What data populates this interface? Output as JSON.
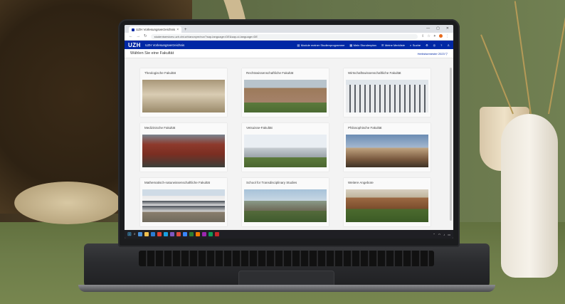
{
  "browser": {
    "tab_title": "UZH Vorlesungsverzeichnis",
    "tab_close": "×",
    "new_tab": "+",
    "window_controls": [
      "—",
      "▢",
      "✕"
    ],
    "url": "studentservices.uzh.ch/uzh/anonym/vvz/?sap-language=DE&sap-ui-language=DE"
  },
  "header": {
    "logo": "UZH",
    "title": "UZH Vorlesungsverzeichnis",
    "links": [
      {
        "icon": "book-icon",
        "label": "Module meiner Studienprogramme"
      },
      {
        "icon": "calendar-icon",
        "label": "Mein Stundenplan"
      },
      {
        "icon": "list-icon",
        "label": "Meine Merkliste"
      },
      {
        "icon": "search-icon",
        "label": "Suche"
      }
    ]
  },
  "subheader": {
    "title": "Wählen Sie eine Fakultät",
    "semester": "Herbstsemester 2023 ▽"
  },
  "faculties": [
    {
      "label": "Theologische Fakultät"
    },
    {
      "label": "Rechtswissenschaftliche Fakultät"
    },
    {
      "label": "Wirtschaftswissenschaftliche Fakultät"
    },
    {
      "label": "Medizinische Fakultät"
    },
    {
      "label": "Vetsuisse-Fakultät"
    },
    {
      "label": "Philosophische Fakultät"
    },
    {
      "label": "Mathematisch-naturwissenschaftliche Fakultät"
    },
    {
      "label": "School for Transdisciplinary Studies"
    },
    {
      "label": "Weitere Angebote"
    }
  ],
  "colors": {
    "uzh_blue": "#0028a5",
    "background": "#f3f3f3"
  }
}
